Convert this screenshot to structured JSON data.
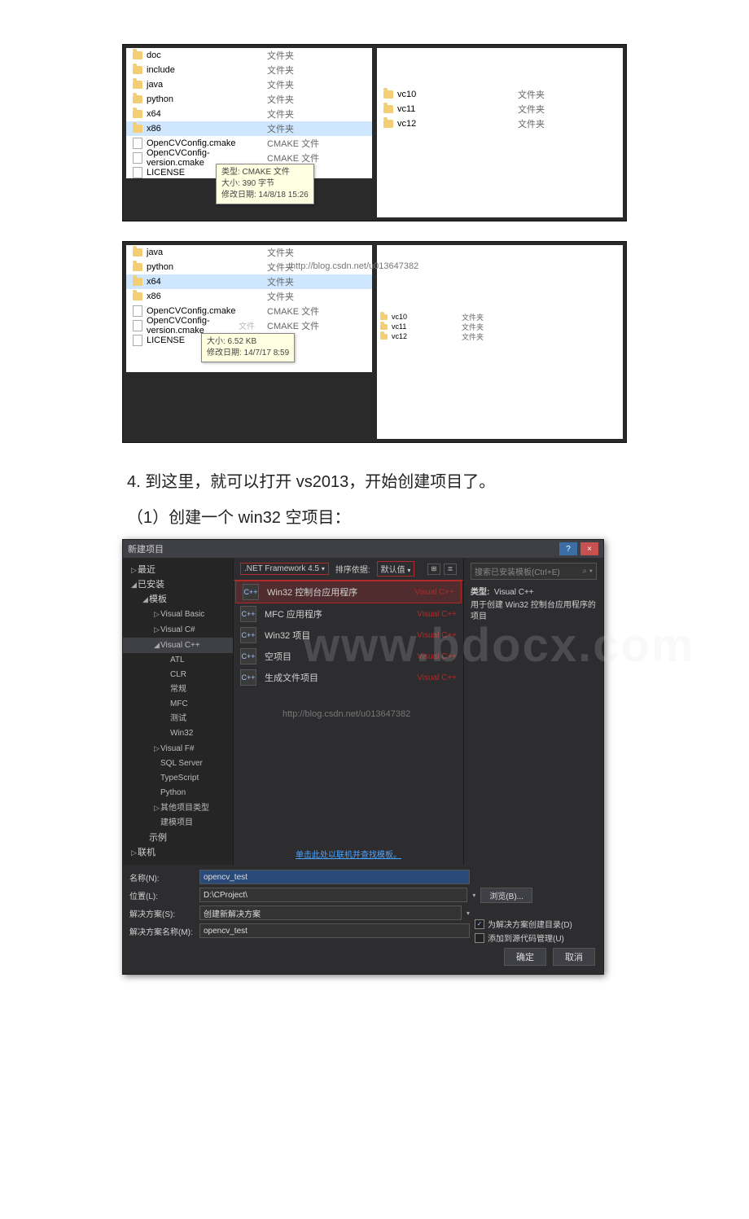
{
  "explorer1_left": [
    {
      "name": "doc",
      "type": "文件夹",
      "icon": "folder"
    },
    {
      "name": "include",
      "type": "文件夹",
      "icon": "folder"
    },
    {
      "name": "java",
      "type": "文件夹",
      "icon": "folder"
    },
    {
      "name": "python",
      "type": "文件夹",
      "icon": "folder"
    },
    {
      "name": "x64",
      "type": "文件夹",
      "icon": "folder"
    },
    {
      "name": "x86",
      "type": "文件夹",
      "icon": "folder",
      "selected": true
    },
    {
      "name": "OpenCVConfig.cmake",
      "type": "CMAKE 文件",
      "icon": "file"
    },
    {
      "name": "OpenCVConfig-version.cmake",
      "type": "CMAKE 文件",
      "icon": "file"
    },
    {
      "name": "LICENSE",
      "type": "",
      "icon": "file"
    }
  ],
  "explorer1_tooltip": {
    "line1": "类型: CMAKE 文件",
    "line2": "大小: 390 字节",
    "line3": "修改日期: 14/8/18 15:26"
  },
  "explorer1_right": [
    {
      "name": "vc10",
      "type": "文件夹",
      "icon": "folder"
    },
    {
      "name": "vc11",
      "type": "文件夹",
      "icon": "folder"
    },
    {
      "name": "vc12",
      "type": "文件夹",
      "icon": "folder"
    }
  ],
  "explorer2_left": [
    {
      "name": "java",
      "type": "文件夹",
      "icon": "folder"
    },
    {
      "name": "python",
      "type": "文件夹",
      "icon": "folder"
    },
    {
      "name": "x64",
      "type": "文件夹",
      "icon": "folder",
      "selected": true
    },
    {
      "name": "x86",
      "type": "文件夹",
      "icon": "folder"
    },
    {
      "name": "OpenCVConfig.cmake",
      "type": "CMAKE 文件",
      "icon": "file"
    },
    {
      "name": "OpenCVConfig-version.cmake",
      "type": "CMAKE 文件",
      "icon": "file"
    },
    {
      "name": "LICENSE",
      "type": "文件",
      "icon": "file"
    }
  ],
  "explorer2_extra_type": "文件",
  "explorer2_tooltip": {
    "line1": "大小: 6.52 KB",
    "line2": "修改日期: 14/7/17 8:59"
  },
  "explorer2_wm": "http://blog.csdn.net/u013647382",
  "explorer2_right": [
    {
      "name": "vc10",
      "type": "文件夹",
      "icon": "folder"
    },
    {
      "name": "vc11",
      "type": "文件夹",
      "icon": "folder"
    },
    {
      "name": "vc12",
      "type": "文件夹",
      "icon": "folder"
    }
  ],
  "text_step4": "4. 到这里，就可以打开 vs2013，开始创建项目了。",
  "text_step4_1": "（1）创建一个 win32 空项目：",
  "dlg": {
    "title": "新建项目",
    "help": "?",
    "close": "×",
    "tree": [
      {
        "label": "最近",
        "level": 1,
        "tri": "▷"
      },
      {
        "label": "已安装",
        "level": 1,
        "tri": "◢"
      },
      {
        "label": "模板",
        "level": 2,
        "tri": "◢"
      },
      {
        "label": "Visual Basic",
        "level": 3,
        "tri": "▷"
      },
      {
        "label": "Visual C#",
        "level": 3,
        "tri": "▷"
      },
      {
        "label": "Visual C++",
        "level": 3,
        "tri": "◢",
        "sel": true
      },
      {
        "label": "ATL",
        "level": 3,
        "indent": 1
      },
      {
        "label": "CLR",
        "level": 3,
        "indent": 1
      },
      {
        "label": "常规",
        "level": 3,
        "indent": 1
      },
      {
        "label": "MFC",
        "level": 3,
        "indent": 1
      },
      {
        "label": "测试",
        "level": 3,
        "indent": 1
      },
      {
        "label": "Win32",
        "level": 3,
        "indent": 1
      },
      {
        "label": "Visual F#",
        "level": 3,
        "tri": "▷"
      },
      {
        "label": "SQL Server",
        "level": 3
      },
      {
        "label": "TypeScript",
        "level": 3
      },
      {
        "label": "Python",
        "level": 3
      },
      {
        "label": "其他项目类型",
        "level": 3,
        "tri": "▷"
      },
      {
        "label": "建模项目",
        "level": 3
      },
      {
        "label": "示例",
        "level": 2
      },
      {
        "label": "联机",
        "level": 1,
        "tri": "▷"
      }
    ],
    "toolbar": {
      "fw": ".NET Framework 4.5",
      "sort": "排序依据:",
      "sortval": "默认值"
    },
    "templates": [
      {
        "name": "Win32 控制台应用程序",
        "lang": "Visual C++",
        "sel": true
      },
      {
        "name": "MFC 应用程序",
        "lang": "Visual C++"
      },
      {
        "name": "Win32 项目",
        "lang": "Visual C++"
      },
      {
        "name": "空项目",
        "lang": "Visual C++"
      },
      {
        "name": "生成文件项目",
        "lang": "Visual C++"
      }
    ],
    "online_link": "单击此处以联机并查找模板。",
    "right": {
      "search": "搜索已安装模板(Ctrl+E)",
      "search_icon": "⌕ ▾",
      "type_label": "类型:",
      "type_value": "Visual C++",
      "desc": "用于创建 Win32 控制台应用程序的项目"
    },
    "form": {
      "name_label": "名称(N):",
      "name_value": "opencv_test",
      "loc_label": "位置(L):",
      "loc_value": "D:\\CProject\\",
      "browse": "浏览(B)...",
      "sol_label": "解决方案(S):",
      "sol_value": "创建新解决方案",
      "solname_label": "解决方案名称(M):",
      "solname_value": "opencv_test",
      "chk1": "为解决方案创建目录(D)",
      "chk2": "添加到源代码管理(U)",
      "ok": "确定",
      "cancel": "取消"
    },
    "wm_big": "www.bdocx.com",
    "wm_url": "http://blog.csdn.net/u013647382"
  }
}
